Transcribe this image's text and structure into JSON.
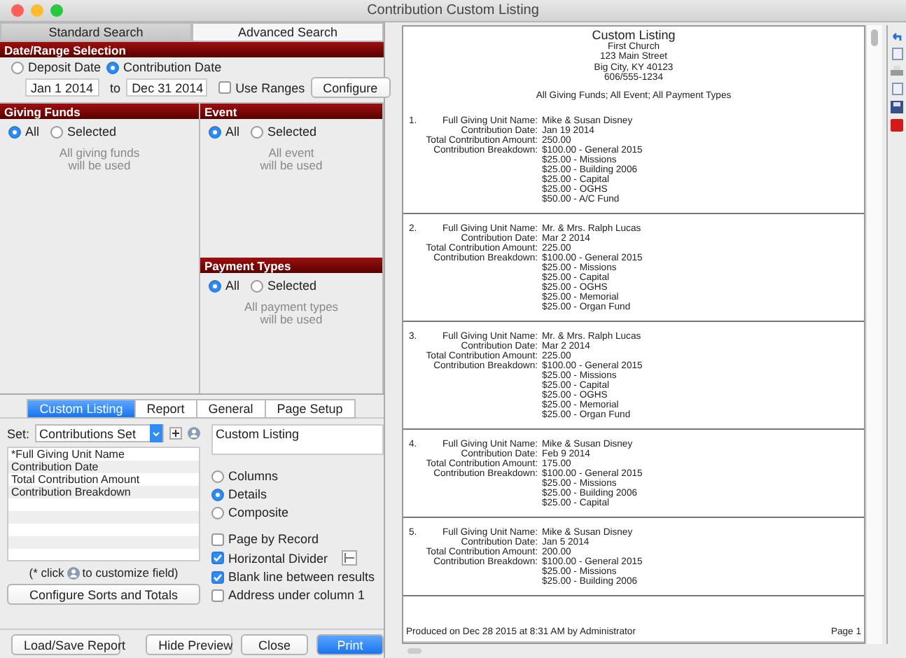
{
  "window": {
    "title": "Contribution Custom Listing"
  },
  "search_tabs": [
    {
      "label": "Standard Search",
      "selected": true
    },
    {
      "label": "Advanced Search",
      "selected": false
    }
  ],
  "date_range": {
    "title": "Date/Range Selection",
    "options": [
      {
        "label": "Deposit Date",
        "selected": false
      },
      {
        "label": "Contribution Date",
        "selected": true
      }
    ],
    "from": "Jan 1 2014",
    "to_label": "to",
    "to": "Dec 31 2014",
    "use_ranges": {
      "label": "Use Ranges",
      "checked": false
    },
    "configure_button": "Configure"
  },
  "filters": [
    {
      "title": "Giving Funds",
      "options": [
        {
          "label": "All",
          "selected": true
        },
        {
          "label": "Selected",
          "selected": false
        }
      ],
      "note": [
        "All giving funds",
        "will be used"
      ]
    },
    {
      "title": "Event",
      "options": [
        {
          "label": "All",
          "selected": true
        },
        {
          "label": "Selected",
          "selected": false
        }
      ],
      "note": [
        "All event",
        "will be used"
      ]
    },
    {
      "title": "Payment Types",
      "options": [
        {
          "label": "All",
          "selected": true
        },
        {
          "label": "Selected",
          "selected": false
        }
      ],
      "note": [
        "All payment types",
        "will be used"
      ]
    }
  ],
  "report_tabs": [
    {
      "label": "Custom Listing",
      "selected": true
    },
    {
      "label": "Report",
      "selected": false
    },
    {
      "label": "General",
      "selected": false
    },
    {
      "label": "Page Setup",
      "selected": false
    }
  ],
  "set": {
    "label": "Set:",
    "value": "Contributions Set"
  },
  "fields": [
    "*Full Giving Unit Name",
    "Contribution Date",
    "Total Contribution Amount",
    "Contribution Breakdown"
  ],
  "title_field": "Custom Listing",
  "layouts": [
    {
      "label": "Columns",
      "selected": false
    },
    {
      "label": "Details",
      "selected": true
    },
    {
      "label": "Composite",
      "selected": false
    }
  ],
  "options": [
    {
      "label": "Page by Record",
      "checked": false,
      "kind": "plain"
    },
    {
      "label": "Horizontal Divider",
      "checked": true,
      "kind": "divider"
    },
    {
      "label": "Blank line between results",
      "checked": true,
      "kind": "plain"
    },
    {
      "label": "Address under column 1",
      "checked": false,
      "kind": "plain"
    }
  ],
  "hint": {
    "before": "(* click",
    "after": "to customize field)"
  },
  "configure_sorts_button": "Configure Sorts and Totals",
  "buttons": [
    {
      "label": "Load/Save Report",
      "kind": "normal"
    },
    {
      "label": "Hide Preview",
      "kind": "normal"
    },
    {
      "label": "Close",
      "kind": "normal"
    },
    {
      "label": "Print",
      "kind": "primary"
    }
  ],
  "preview": {
    "title": "Custom Listing",
    "header_lines": [
      "First Church",
      "123 Main Street",
      "Big City, KY  40123",
      "606/555-1234"
    ],
    "criteria": "All Giving Funds; All Event; All Payment Types",
    "records": [
      {
        "number": "1.",
        "fields": [
          {
            "label": "Full Giving Unit Name:",
            "values": [
              "Mike & Susan Disney"
            ]
          },
          {
            "label": "Contribution Date:",
            "values": [
              "Jan 19 2014"
            ]
          },
          {
            "label": "Total Contribution Amount:",
            "values": [
              "250.00"
            ]
          },
          {
            "label": "Contribution Breakdown:",
            "values": [
              "$100.00 - General 2015",
              "$25.00 - Missions",
              "$25.00 - Building 2006",
              "$25.00 - Capital",
              "$25.00 - OGHS",
              "$50.00 - A/C Fund"
            ]
          }
        ]
      },
      {
        "number": "2.",
        "fields": [
          {
            "label": "Full Giving Unit Name:",
            "values": [
              "Mr. & Mrs. Ralph Lucas"
            ]
          },
          {
            "label": "Contribution Date:",
            "values": [
              "Mar 2 2014"
            ]
          },
          {
            "label": "Total Contribution Amount:",
            "values": [
              "225.00"
            ]
          },
          {
            "label": "Contribution Breakdown:",
            "values": [
              "$100.00 - General 2015",
              "$25.00 - Missions",
              "$25.00 - Capital",
              "$25.00 - OGHS",
              "$25.00 - Memorial",
              "$25.00 - Organ Fund"
            ]
          }
        ]
      },
      {
        "number": "3.",
        "fields": [
          {
            "label": "Full Giving Unit Name:",
            "values": [
              "Mr. & Mrs. Ralph Lucas"
            ]
          },
          {
            "label": "Contribution Date:",
            "values": [
              "Mar 2 2014"
            ]
          },
          {
            "label": "Total Contribution Amount:",
            "values": [
              "225.00"
            ]
          },
          {
            "label": "Contribution Breakdown:",
            "values": [
              "$100.00 - General 2015",
              "$25.00 - Missions",
              "$25.00 - Capital",
              "$25.00 - OGHS",
              "$25.00 - Memorial",
              "$25.00 - Organ Fund"
            ]
          }
        ]
      },
      {
        "number": "4.",
        "fields": [
          {
            "label": "Full Giving Unit Name:",
            "values": [
              "Mike & Susan Disney"
            ]
          },
          {
            "label": "Contribution Date:",
            "values": [
              "Feb 9 2014"
            ]
          },
          {
            "label": "Total Contribution Amount:",
            "values": [
              "175.00"
            ]
          },
          {
            "label": "Contribution Breakdown:",
            "values": [
              "$100.00 - General 2015",
              "$25.00 - Missions",
              "$25.00 - Building 2006",
              "$25.00 - Capital"
            ]
          }
        ]
      },
      {
        "number": "5.",
        "fields": [
          {
            "label": "Full Giving Unit Name:",
            "values": [
              "Mike & Susan Disney"
            ]
          },
          {
            "label": "Contribution Date:",
            "values": [
              "Jan 5 2014"
            ]
          },
          {
            "label": "Total Contribution Amount:",
            "values": [
              "200.00"
            ]
          },
          {
            "label": "Contribution Breakdown:",
            "values": [
              "$100.00 - General 2015",
              "$25.00 - Missions",
              "$25.00 - Building 2006"
            ]
          }
        ]
      }
    ],
    "footer": "Produced on Dec 28 2015 at 8:31 AM by Administrator",
    "page": "Page 1"
  }
}
